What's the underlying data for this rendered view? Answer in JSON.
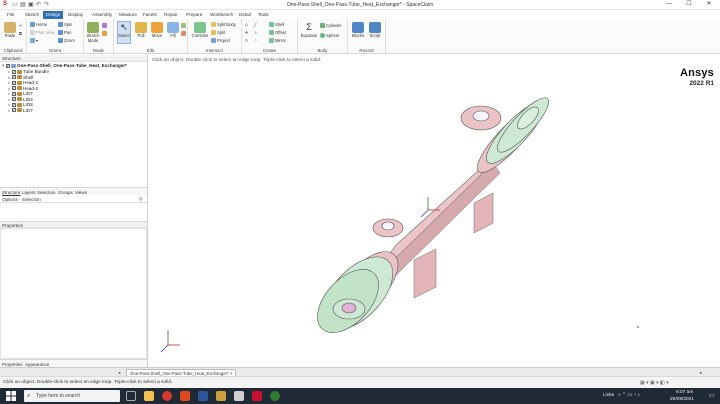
{
  "window": {
    "title": "One-Pass-Shell_One-Pass-Tube_Heat_Exchanger* - SpaceClaim",
    "minimize": "—",
    "maximize": "☐",
    "close": "✕"
  },
  "menu": {
    "tabs": [
      "File",
      "Sketch",
      "Design",
      "Display",
      "Assembly",
      "Measure",
      "Facets",
      "Repair",
      "Prepare",
      "Workbench",
      "Detail",
      "Tools"
    ],
    "active": "Design"
  },
  "ribbon": {
    "clipboard": {
      "label": "Clipboard",
      "paste": "Paste"
    },
    "orient": {
      "label": "Orient",
      "home": "Home",
      "plan_view": "Plan View",
      "zoom": "Zoom",
      "spin": "Spin",
      "pan": "Pan"
    },
    "mode": {
      "label": "Mode",
      "sketch_mode": "Sketch Mode",
      "section_mode": "Section Mode"
    },
    "edit": {
      "label": "Edit",
      "select": "Select",
      "pull": "Pull",
      "move": "Move",
      "fill": "Fill"
    },
    "intersect": {
      "label": "Intersect",
      "combine": "Combine",
      "split_body": "Split Body",
      "split": "Split",
      "project": "Project"
    },
    "create": {
      "label": "Create",
      "shell": "Shell",
      "offset": "Offset",
      "mirror": "Mirror"
    },
    "body": {
      "label": "Body",
      "equation": "Equation",
      "cylinder": "Cylinder",
      "sphere": "Sphere"
    },
    "record": {
      "label": "Record",
      "blocks": "Blocks",
      "script": "Script"
    }
  },
  "structure": {
    "header": "Structure",
    "root": "One-Pass-Shell_One-Pass-Tube_Heat_Exchanger*",
    "items": [
      "Tube Bundle",
      "Shell",
      "Head-2",
      "Head-2",
      "LID7",
      "LID3",
      "LID8",
      "LID7"
    ],
    "tabs": [
      "Structure",
      "Layers",
      "Selection",
      "Groups",
      "Views"
    ],
    "options_header": "Options - Selection"
  },
  "properties": {
    "header": "Properties",
    "tabs": [
      "Properties",
      "Appearance"
    ]
  },
  "viewport": {
    "hint": "Click an object. Double-click to select an edge loop. Triple-click to select a solid.",
    "brand_name": "Ansys",
    "brand_version": "2022 R1"
  },
  "document_tab": {
    "label": "One-Pass-Shell_One-Pass-Tube_Heat_Exchanger*",
    "close": "×"
  },
  "status": {
    "message": "Click an object. Double-click to select an edge loop. Triple-click to select a solid."
  },
  "taskbar": {
    "search_placeholder": "Type here to search",
    "links": "Links",
    "time": "8:07 am",
    "date": "26/09/2021"
  },
  "colors": {
    "shell_pink": "#e9c3c6",
    "head_green": "#c8e8cf",
    "accent_blue": "#2f6fb3",
    "taskbar": "#1f2a36"
  }
}
